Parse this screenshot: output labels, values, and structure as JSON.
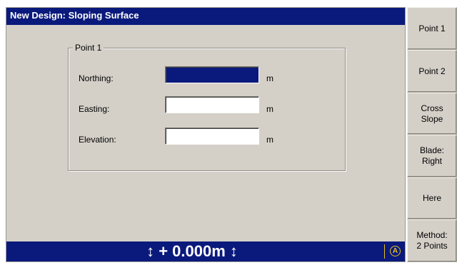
{
  "window": {
    "title": "New Design: Sloping Surface"
  },
  "group": {
    "legend": "Point 1",
    "fields": [
      {
        "label": "Northing:",
        "value": "",
        "unit": "m"
      },
      {
        "label": "Easting:",
        "value": "",
        "unit": "m"
      },
      {
        "label": "Elevation:",
        "value": "",
        "unit": "m"
      }
    ]
  },
  "status": {
    "readout": "↕ + 0.000m ↕",
    "icon_letter": "A"
  },
  "softkeys": [
    {
      "label": "Point 1"
    },
    {
      "label": "Point 2"
    },
    {
      "label": "Cross\nSlope"
    },
    {
      "label": "Blade:\nRight"
    },
    {
      "label": "Here"
    },
    {
      "label": "Method:\n2 Points"
    }
  ],
  "colors": {
    "title_bar": "#0a1a7c",
    "panel": "#d4d0c8",
    "active_field": "#0a1a7c",
    "status_accent": "#e8c020"
  }
}
